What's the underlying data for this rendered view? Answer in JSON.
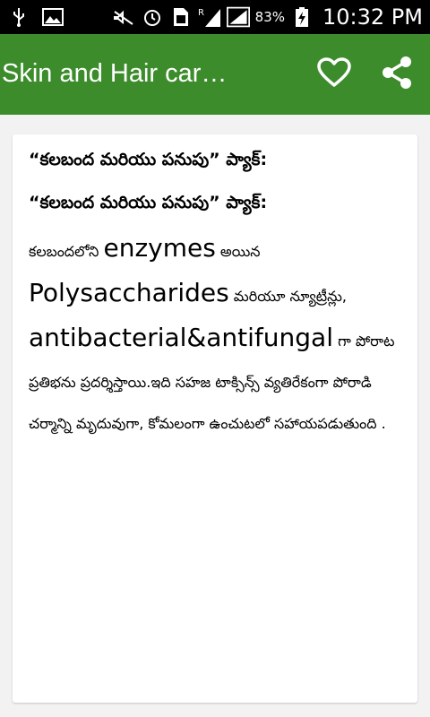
{
  "status_bar": {
    "battery": "83%",
    "time": "10:32 PM",
    "icons": [
      "usb-icon",
      "image-icon",
      "mute-icon",
      "alarm-icon",
      "sim-icon",
      "signal-roaming-icon",
      "signal-icon",
      "battery-charging-icon"
    ]
  },
  "app_bar": {
    "title": "Skin and Hair car…",
    "favorite_icon": "heart-outline-icon",
    "share_icon": "share-icon",
    "color": "#3c8c2c"
  },
  "article": {
    "heading_1": "“కలబంద మరియు పనుపు” ప్యాక్:",
    "heading_2": "“కలబంద మరియు పనుపు” ప్యాక్:",
    "body": {
      "t1": "కలబందలోని ",
      "t2": "enzymes",
      "t3": " అయిన ",
      "t4": "Polysaccharides",
      "t5": " మరియూ న్యూట్రీన్లు, ",
      "t6": "antibacterial&antifungal",
      "t7": " గా పోరాట ప్రతిభను ప్రదర్శిస్తాయి.ఇది సహజ టాక్సిన్స్ వ్యతిరేకంగా పోరాడి చర్మాన్ని మృదువుగా, కోమలంగా ఉంచుటలో సహాయపడుతుంది ."
    }
  }
}
